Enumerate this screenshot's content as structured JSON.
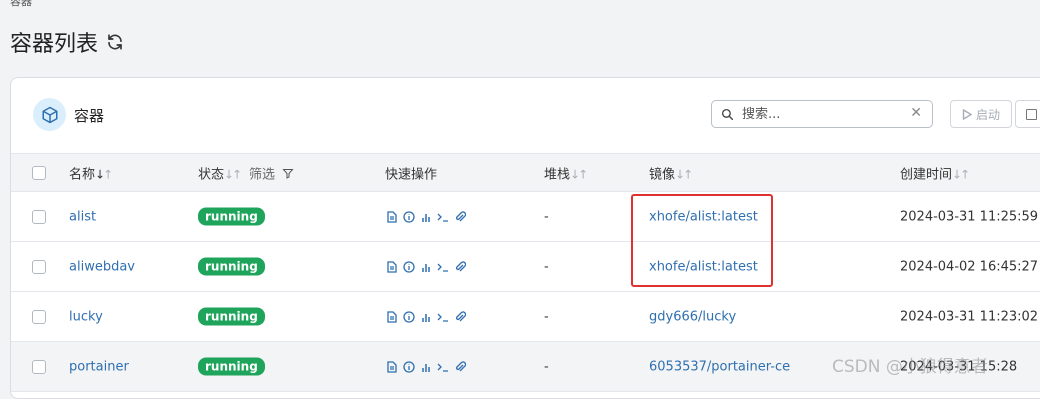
{
  "breadcrumb": "容器",
  "page_title": "容器列表",
  "card": {
    "title": "容器",
    "search_placeholder": "搜索...",
    "start_label": "启动"
  },
  "columns": {
    "name": "名称",
    "state": "状态",
    "filter": "筛选",
    "quick_actions": "快速操作",
    "stack": "堆栈",
    "image": "镜像",
    "created": "创建时间"
  },
  "rows": [
    {
      "name": "alist",
      "state": "running",
      "stack": "-",
      "image": "xhofe/alist:latest",
      "created": "2024-03-31 11:25:59"
    },
    {
      "name": "aliwebdav",
      "state": "running",
      "stack": "-",
      "image": "xhofe/alist:latest",
      "created": "2024-04-02 16:45:27"
    },
    {
      "name": "lucky",
      "state": "running",
      "stack": "-",
      "image": "gdy666/lucky",
      "created": "2024-03-31 11:23:02"
    },
    {
      "name": "portainer",
      "state": "running",
      "stack": "-",
      "image": "6053537/portainer-ce",
      "created": "2024-03-31 15:28"
    }
  ],
  "watermark": "CSDN @小狼得意者",
  "colors": {
    "running": "#1fa55b",
    "link": "#2f6fb0",
    "highlight": "#e03131"
  }
}
